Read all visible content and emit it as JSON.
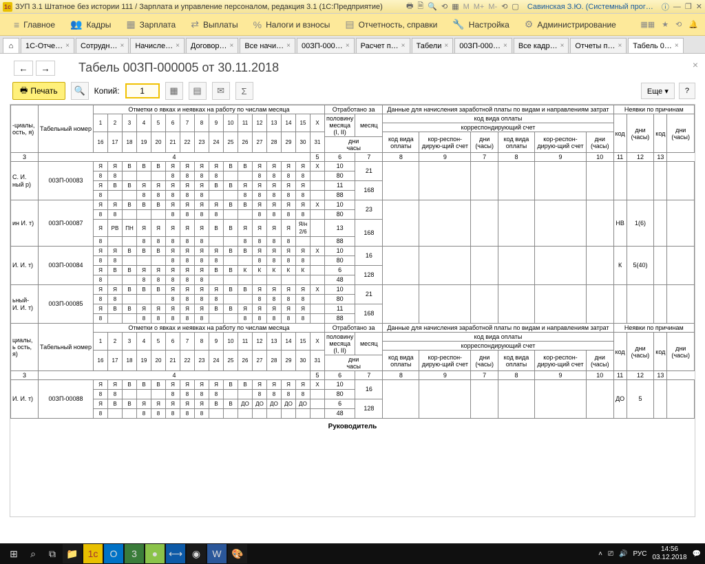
{
  "window": {
    "title": "ЗУП 3.1 Штатное без истории 111 / Зарплата и управление персоналом, редакция 3.1  (1С:Предприятие)",
    "user": "Савинская З.Ю. (Системный прог…",
    "icon1c": "1c"
  },
  "mainmenu": {
    "items": [
      {
        "icon": "≡",
        "label": "Главное"
      },
      {
        "icon": "👥",
        "label": "Кадры"
      },
      {
        "icon": "▦",
        "label": "Зарплата"
      },
      {
        "icon": "⇄",
        "label": "Выплаты"
      },
      {
        "icon": "%",
        "label": "Налоги и взносы"
      },
      {
        "icon": "▤",
        "label": "Отчетность, справки"
      },
      {
        "icon": "🔧",
        "label": "Настройка"
      },
      {
        "icon": "⚙",
        "label": "Администрирование"
      }
    ]
  },
  "tabs": [
    {
      "label": "1С-Отче…",
      "active": false
    },
    {
      "label": "Сотрудн…",
      "active": false
    },
    {
      "label": "Начисле…",
      "active": false
    },
    {
      "label": "Договор…",
      "active": false
    },
    {
      "label": "Все начи…",
      "active": false
    },
    {
      "label": "00ЗП-000…",
      "active": false
    },
    {
      "label": "Расчет п…",
      "active": false
    },
    {
      "label": "Табели",
      "active": false
    },
    {
      "label": "00ЗП-000…",
      "active": false
    },
    {
      "label": "Все кадр…",
      "active": false
    },
    {
      "label": "Отчеты п…",
      "active": false
    },
    {
      "label": "Табель 0…",
      "active": true
    }
  ],
  "doc": {
    "title": "Табель 00ЗП-000005 от 30.11.2018",
    "print_label": "Печать",
    "copies_label": "Копий:",
    "copies_value": "1",
    "more_label": "Еще",
    "help": "?"
  },
  "timesheet": {
    "header_marks": "Отметки о явках и неявках на работу по числам месяца",
    "header_worked": "Отработано за",
    "header_payroll": "Данные для начисления заработной платы по видам и направлениям затрат",
    "header_reasons": "Неявки по причинам",
    "sub_half": "половину месяца (I, II)",
    "sub_month": "месяц",
    "sub_paycode": "код вида оплаты",
    "sub_corr": "корреспондирующий счет",
    "sub_days": "дни",
    "sub_hours": "часы",
    "sub_dh": "дни (часы)",
    "sub_code": "код",
    "sub_paycode2": "код вида оплаты",
    "sub_corr2": "кор-респон-дирую-щий счет",
    "col_name": "-циалы, ость, я)",
    "col_name2": "циалы, ь ость, я)",
    "col_tabnum": "Табельный номер",
    "days1": [
      "1",
      "2",
      "3",
      "4",
      "5",
      "6",
      "7",
      "8",
      "9",
      "10",
      "11",
      "12",
      "13",
      "14",
      "15",
      "X"
    ],
    "days2": [
      "16",
      "17",
      "18",
      "19",
      "20",
      "21",
      "22",
      "23",
      "24",
      "25",
      "26",
      "27",
      "28",
      "29",
      "30",
      "31"
    ],
    "colnums": [
      "3",
      "4",
      "5",
      "6",
      "7",
      "8",
      "9",
      "7",
      "8",
      "9",
      "10",
      "11",
      "12",
      "13"
    ],
    "footer": "Руководитель"
  },
  "rows": [
    {
      "name": "С. И. ный р)",
      "tabnum": "00ЗП-00083",
      "r1": [
        "Я",
        "Я",
        "В",
        "В",
        "В",
        "Я",
        "Я",
        "Я",
        "Я",
        "В",
        "В",
        "Я",
        "Я",
        "Я",
        "Я",
        "Х"
      ],
      "r1b": [
        "8",
        "8",
        "",
        "",
        "",
        "8",
        "8",
        "8",
        "8",
        "",
        "",
        "8",
        "8",
        "8",
        "8",
        ""
      ],
      "r2": [
        "Я",
        "В",
        "В",
        "Я",
        "Я",
        "Я",
        "Я",
        "Я",
        "В",
        "В",
        "Я",
        "Я",
        "Я",
        "Я",
        "Я",
        ""
      ],
      "r2b": [
        "8",
        "",
        "",
        "8",
        "8",
        "8",
        "8",
        "8",
        "",
        "",
        "8",
        "8",
        "8",
        "8",
        "8",
        ""
      ],
      "half": [
        "10",
        "80",
        "11",
        "88"
      ],
      "month": [
        "21",
        "168"
      ],
      "abs_code": "",
      "abs_val": ""
    },
    {
      "name": "ин И.  т)",
      "tabnum": "00ЗП-00087",
      "r1": [
        "Я",
        "Я",
        "В",
        "В",
        "В",
        "Я",
        "Я",
        "Я",
        "Я",
        "В",
        "В",
        "Я",
        "Я",
        "Я",
        "Я",
        "Х"
      ],
      "r1b": [
        "8",
        "8",
        "",
        "",
        "",
        "8",
        "8",
        "8",
        "8",
        "",
        "",
        "8",
        "8",
        "8",
        "8",
        ""
      ],
      "r2": [
        "Я",
        "РВ",
        "ПН",
        "Я",
        "Я",
        "Я",
        "Я",
        "Я",
        "В",
        "В",
        "Я",
        "Я",
        "Я",
        "Я",
        "Я/н 2/6",
        ""
      ],
      "r2b": [
        "8",
        "",
        "",
        "8",
        "8",
        "8",
        "8",
        "8",
        "",
        "",
        "8",
        "8",
        "8",
        "8",
        "",
        ""
      ],
      "half": [
        "10",
        "80",
        "13",
        "88"
      ],
      "month": [
        "23",
        "168"
      ],
      "abs_code": "НВ",
      "abs_val": "1(6)"
    },
    {
      "name": "И. И.  т)",
      "tabnum": "00ЗП-00084",
      "r1": [
        "Я",
        "Я",
        "В",
        "В",
        "В",
        "Я",
        "Я",
        "Я",
        "Я",
        "В",
        "В",
        "Я",
        "Я",
        "Я",
        "Я",
        "Х"
      ],
      "r1b": [
        "8",
        "8",
        "",
        "",
        "",
        "8",
        "8",
        "8",
        "8",
        "",
        "",
        "8",
        "8",
        "8",
        "8",
        ""
      ],
      "r2": [
        "Я",
        "В",
        "В",
        "Я",
        "Я",
        "Я",
        "Я",
        "Я",
        "В",
        "В",
        "К",
        "К",
        "К",
        "К",
        "К",
        ""
      ],
      "r2b": [
        "8",
        "",
        "",
        "8",
        "8",
        "8",
        "8",
        "8",
        "",
        "",
        "",
        "",
        "",
        "",
        "",
        ""
      ],
      "half": [
        "10",
        "80",
        "6",
        "48"
      ],
      "month": [
        "16",
        "128"
      ],
      "abs_code": "К",
      "abs_val": "5(40)"
    },
    {
      "name": "ьный- И. И.  т)",
      "tabnum": "00ЗП-00085",
      "r1": [
        "Я",
        "Я",
        "В",
        "В",
        "В",
        "Я",
        "Я",
        "Я",
        "Я",
        "В",
        "В",
        "Я",
        "Я",
        "Я",
        "Я",
        "Х"
      ],
      "r1b": [
        "8",
        "8",
        "",
        "",
        "",
        "8",
        "8",
        "8",
        "8",
        "",
        "",
        "8",
        "8",
        "8",
        "8",
        ""
      ],
      "r2": [
        "Я",
        "В",
        "В",
        "Я",
        "Я",
        "Я",
        "Я",
        "Я",
        "В",
        "В",
        "Я",
        "Я",
        "Я",
        "Я",
        "Я",
        ""
      ],
      "r2b": [
        "8",
        "",
        "",
        "8",
        "8",
        "8",
        "8",
        "8",
        "",
        "",
        "8",
        "8",
        "8",
        "8",
        "8",
        ""
      ],
      "half": [
        "10",
        "80",
        "11",
        "88"
      ],
      "month": [
        "21",
        "168"
      ],
      "abs_code": "",
      "abs_val": ""
    }
  ],
  "rows2": [
    {
      "name": "И. И.  т)",
      "tabnum": "00ЗП-00088",
      "r1": [
        "Я",
        "Я",
        "В",
        "В",
        "В",
        "Я",
        "Я",
        "Я",
        "Я",
        "В",
        "В",
        "Я",
        "Я",
        "Я",
        "Я",
        "Х"
      ],
      "r1b": [
        "8",
        "8",
        "",
        "",
        "",
        "8",
        "8",
        "8",
        "8",
        "",
        "",
        "8",
        "8",
        "8",
        "8",
        ""
      ],
      "r2": [
        "Я",
        "В",
        "В",
        "Я",
        "Я",
        "Я",
        "Я",
        "Я",
        "В",
        "В",
        "ДО",
        "ДО",
        "ДО",
        "ДО",
        "ДО",
        ""
      ],
      "r2b": [
        "8",
        "",
        "",
        "8",
        "8",
        "8",
        "8",
        "8",
        "",
        "",
        "",
        "",
        "",
        "",
        "",
        ""
      ],
      "half": [
        "10",
        "80",
        "6",
        "48"
      ],
      "month": [
        "16",
        "128"
      ],
      "abs_code": "ДО",
      "abs_val": "5"
    }
  ],
  "taskbar": {
    "time": "14:56",
    "date": "03.12.2018",
    "lang": "РУС"
  }
}
